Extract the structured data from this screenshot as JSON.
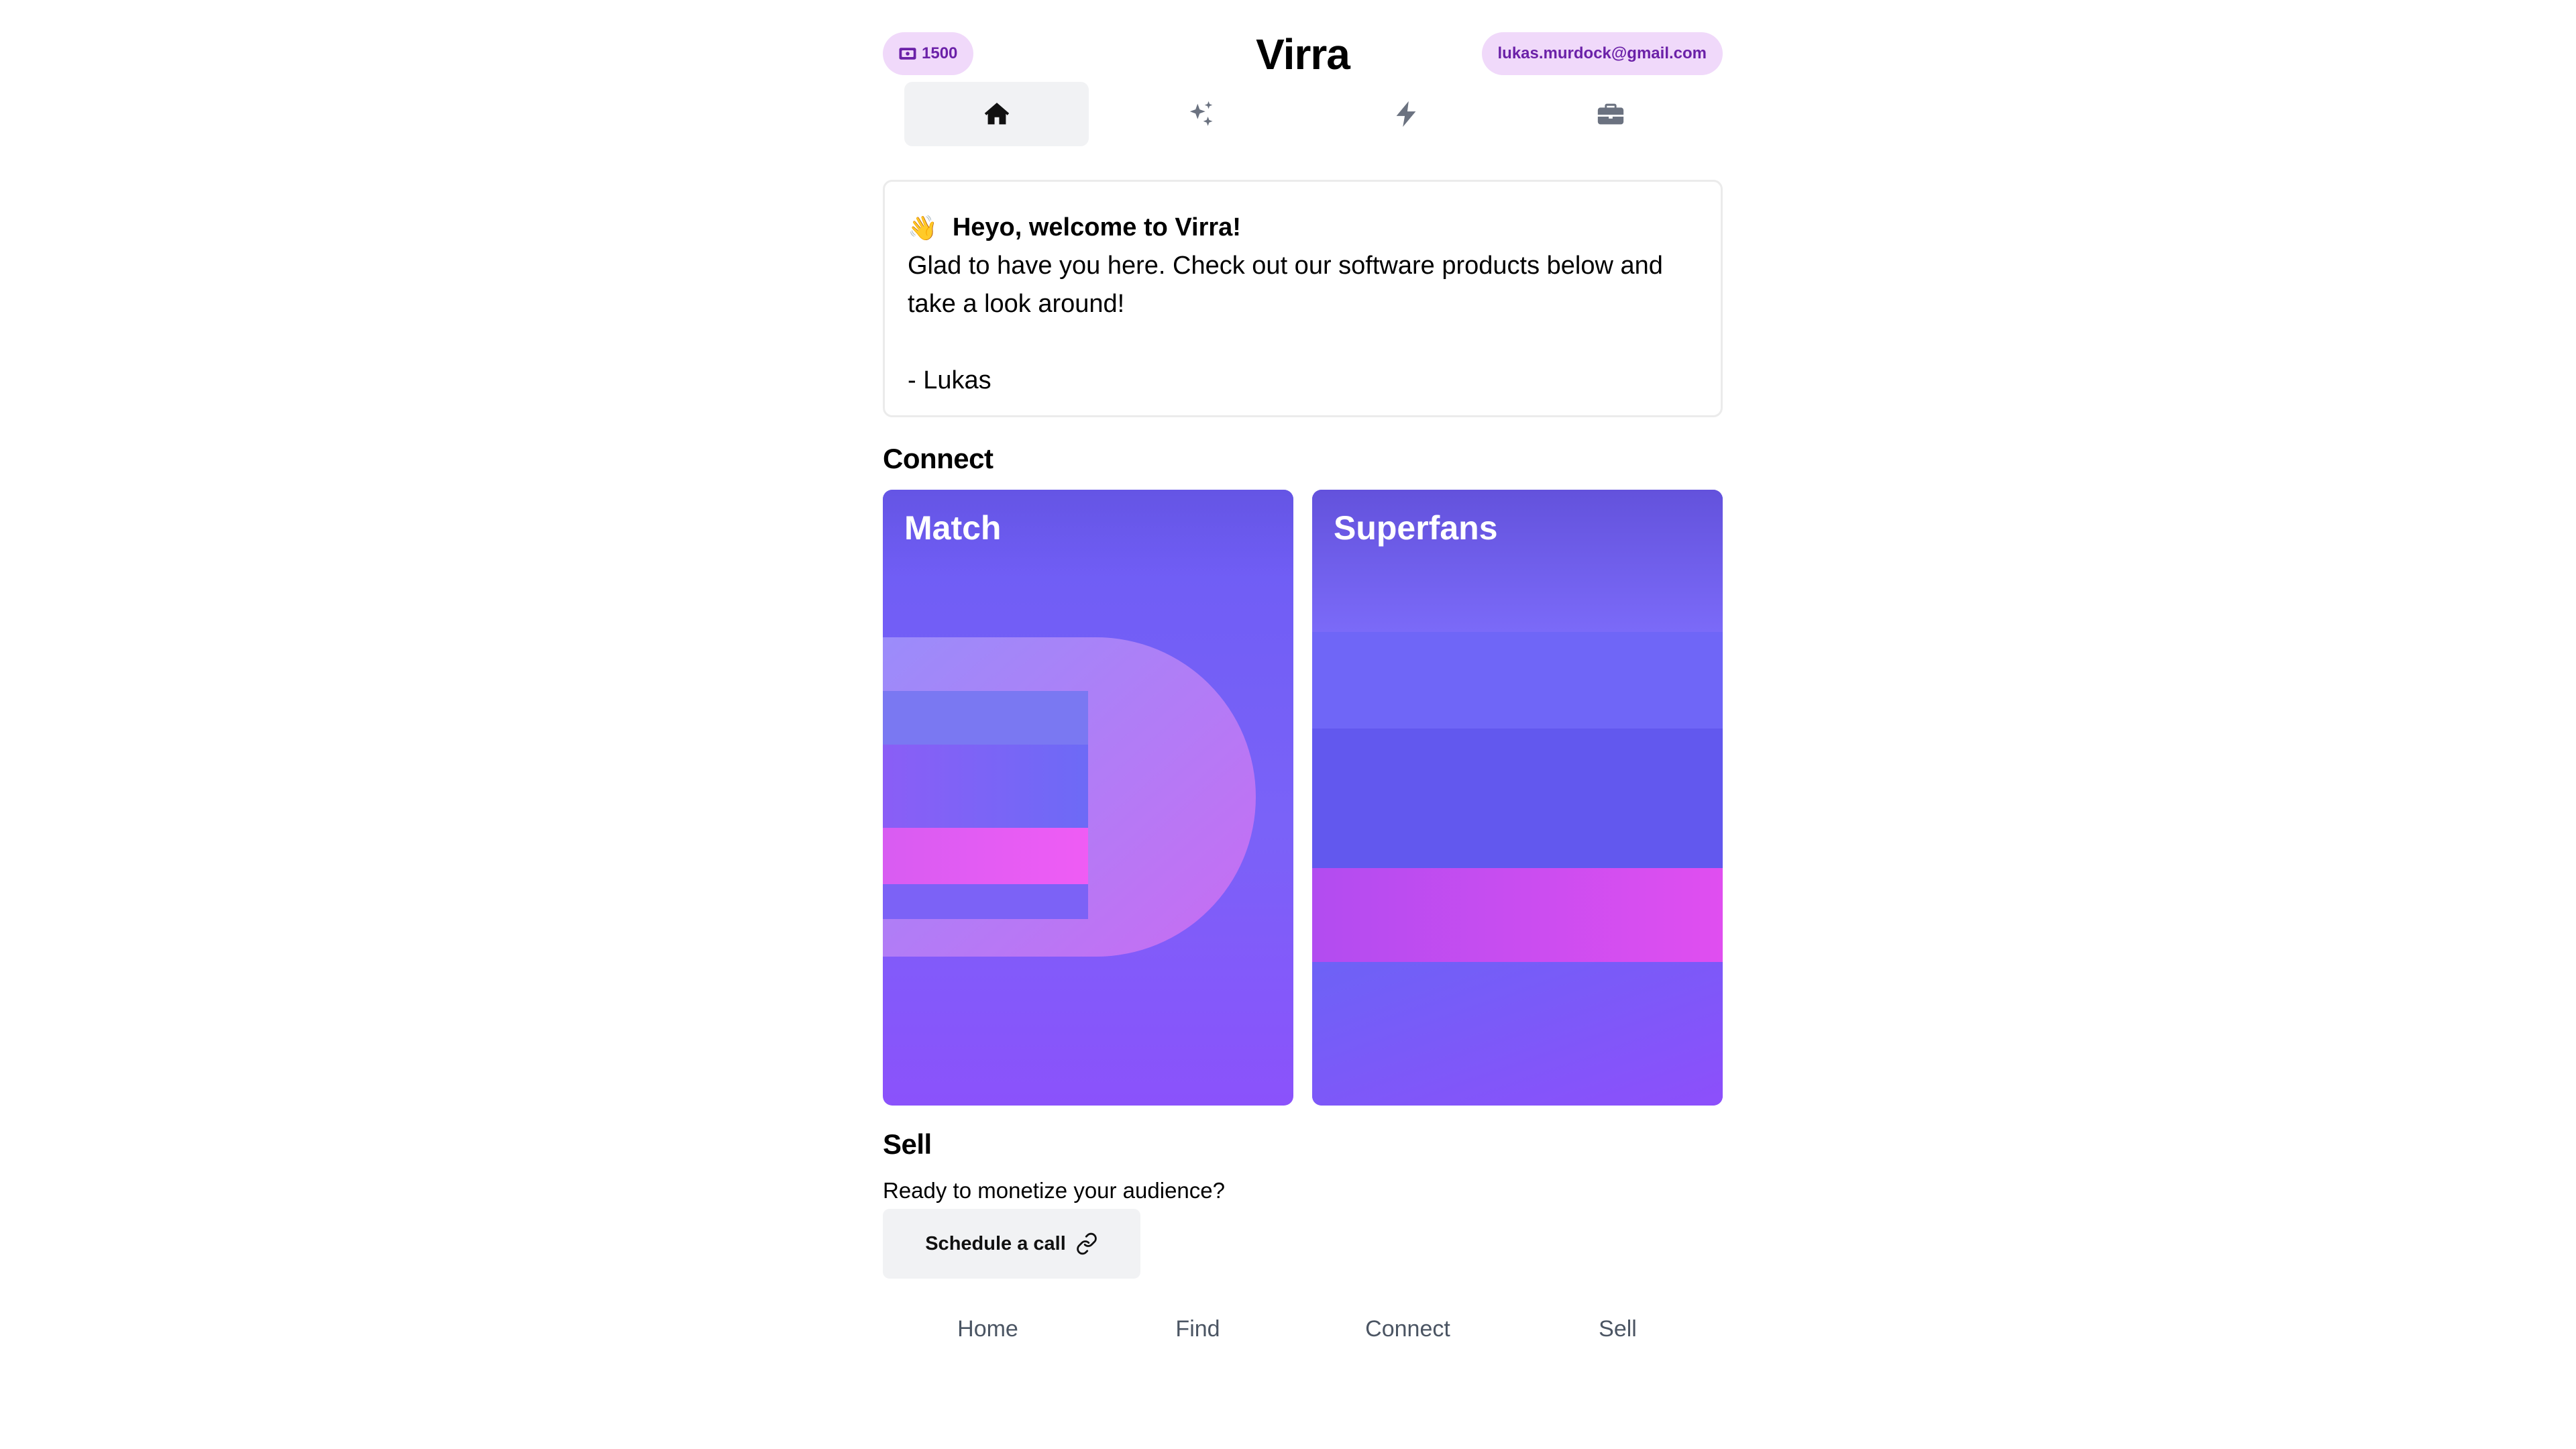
{
  "header": {
    "credits": "1500",
    "credits_icon": "ticket-icon",
    "app_title": "Virra",
    "user_email": "lukas.murdock@gmail.com"
  },
  "tabs": [
    {
      "icon": "home-icon",
      "active": true
    },
    {
      "icon": "sparkles-icon",
      "active": false
    },
    {
      "icon": "lightning-icon",
      "active": false
    },
    {
      "icon": "briefcase-icon",
      "active": false
    }
  ],
  "welcome": {
    "emoji": "👋",
    "title": "Heyo, welcome to Virra!",
    "body": "Glad to have you here. Check out our software products below and take a look around!",
    "signature": "- Lukas"
  },
  "connect": {
    "heading": "Connect",
    "cards": [
      {
        "label": "Match"
      },
      {
        "label": "Superfans"
      }
    ]
  },
  "sell": {
    "heading": "Sell",
    "text": "Ready to monetize your audience?",
    "button_label": "Schedule a call",
    "button_icon": "link-icon"
  },
  "bottom_nav": [
    {
      "label": "Home"
    },
    {
      "label": "Find"
    },
    {
      "label": "Connect"
    },
    {
      "label": "Sell"
    }
  ],
  "colors": {
    "pill_bg": "#f0d9fa",
    "pill_text": "#6b21a8",
    "card_gradient_start": "#6d5cf4",
    "card_gradient_end": "#8b52fb",
    "accent_pink": "#e85cf0"
  }
}
